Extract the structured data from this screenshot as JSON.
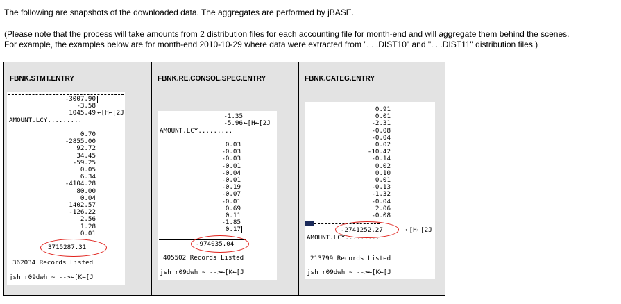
{
  "intro": "The following are snapshots of the downloaded data.  The aggregates are performed by jBASE.",
  "note_line1": "(Please note that the process will take amounts from 2 distribution files for each accounting file for month-end and will aggregate them behind the scenes.",
  "note_line2": "For example, the examples below are for month-end 2010-10-29 where data were extracted from \". . .DIST10\" and \". . .DIST11\" distribution files.)",
  "columns": [
    {
      "header": "FBNK.STMT.ENTRY",
      "top_values": "-3007.90\n-3.58\n1045.49",
      "top_escape": "←[H←[2J",
      "label": "AMOUNT.LCY.........",
      "values": "0.70\n-2855.00\n92.72\n34.45\n-59.25\n0.05\n6.34\n-4104.28\n80.00\n0.04\n1402.57\n-126.22\n2.56\n1.28\n0.01",
      "separator": "==================",
      "total": "3715287.31",
      "records": "362034 Records Listed",
      "prompt": "jsh r09dwh ~ -->←[K←[J"
    },
    {
      "header": "FBNK.RE.CONSOL.SPEC.ENTRY",
      "top_values": "-1.35\n-5.96",
      "top_escape": "←[H←[2J",
      "label": "AMOUNT.LCY.........",
      "values": "0.03\n-0.03\n-0.03\n-0.01\n-0.04\n-0.01\n-0.19\n-0.07\n-0.01\n0.69\n0.11\n-1.85\n0.17",
      "separator": "==================",
      "total": "-974035.04",
      "records": "405502 Records Listed",
      "prompt": "jsh r09dwh ~ -->←[K←[J"
    },
    {
      "header": "FBNK.CATEG.ENTRY",
      "values": "0.91\n0.01\n-2.31\n-0.08\n-0.04\n0.02\n-10.42\n-0.14\n0.02\n0.10\n0.01\n-0.13\n-1.32\n-0.04\n2.06\n-0.08",
      "separator": "==================",
      "total": "-2741252.27",
      "total_escape": "←[H←[2J",
      "label": "AMOUNT.LCY.........",
      "records": "213799 Records Listed",
      "prompt": "jsh r09dwh ~ -->←[K←[J"
    }
  ],
  "colors": {
    "highlight_circle": "#e0201a",
    "panel_bg": "#e3e3e3",
    "terminal_bg": "#ffffff"
  }
}
